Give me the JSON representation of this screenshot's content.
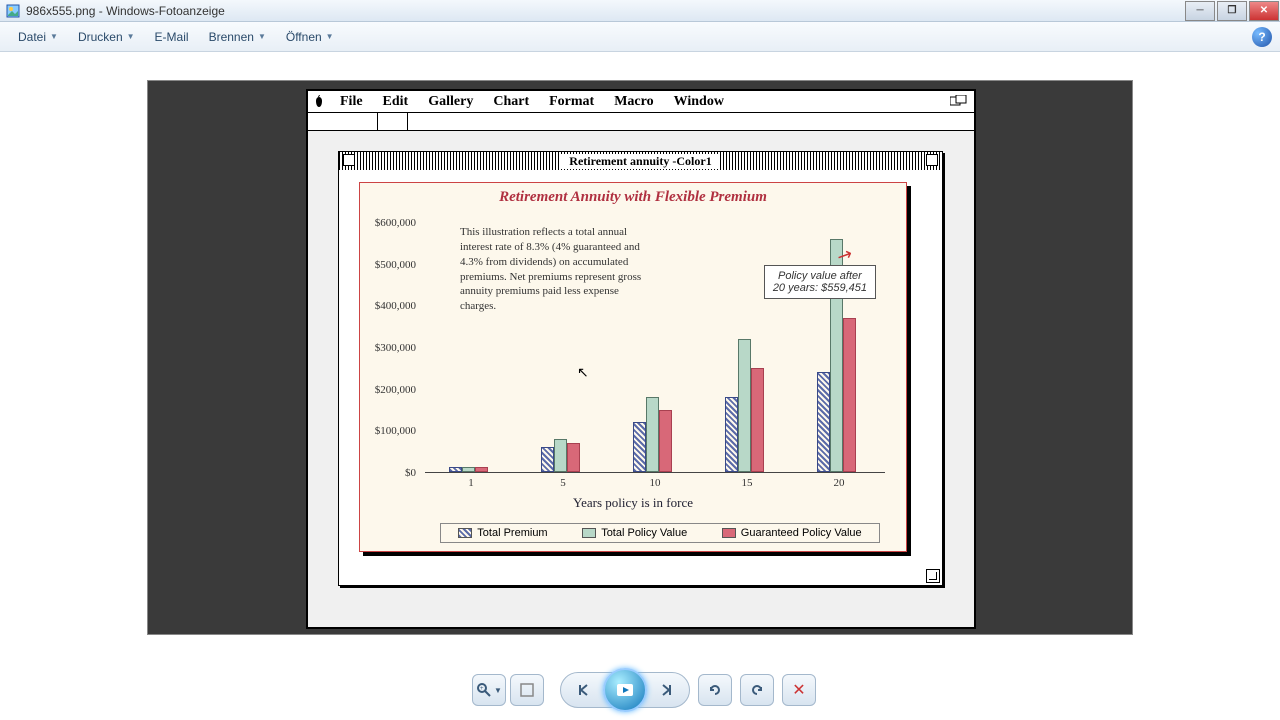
{
  "window": {
    "title": "986x555.png - Windows-Fotoanzeige"
  },
  "menubar": {
    "datei": "Datei",
    "drucken": "Drucken",
    "email": "E-Mail",
    "brennen": "Brennen",
    "oeffnen": "Öffnen"
  },
  "mac_menubar": {
    "file": "File",
    "edit": "Edit",
    "gallery": "Gallery",
    "chart": "Chart",
    "format": "Format",
    "macro": "Macro",
    "window": "Window"
  },
  "mac_doc": {
    "title": "Retirement annuity -Color1"
  },
  "chart": {
    "title": "Retirement Annuity with Flexible Premium",
    "note": "This illustration reflects a total annual interest rate of 8.3% (4% guaranteed and 4.3% from dividends) on accumulated premiums. Net premiums represent gross annuity premiums paid less expense charges.",
    "callout_line1": "Policy value after",
    "callout_line2": "20 years:  $559,451",
    "xlabel": "Years policy is in force",
    "yticks": [
      "$0",
      "$100,000",
      "$200,000",
      "$300,000",
      "$400,000",
      "$500,000",
      "$600,000"
    ],
    "xticks": [
      "1",
      "5",
      "10",
      "15",
      "20"
    ],
    "legend": {
      "premium": "Total Premium",
      "total": "Total Policy Value",
      "guaranteed": "Guaranteed Policy Value"
    }
  },
  "chart_data": {
    "type": "bar",
    "title": "Retirement Annuity with Flexible Premium",
    "xlabel": "Years policy is in force",
    "ylabel": "",
    "ylim": [
      0,
      600000
    ],
    "categories": [
      1,
      5,
      10,
      15,
      20
    ],
    "series": [
      {
        "name": "Total Premium",
        "values": [
          12000,
          60000,
          120000,
          180000,
          240000
        ]
      },
      {
        "name": "Total Policy Value",
        "values": [
          13000,
          80000,
          180000,
          320000,
          559451
        ]
      },
      {
        "name": "Guaranteed Policy Value",
        "values": [
          12500,
          70000,
          150000,
          250000,
          370000
        ]
      }
    ],
    "annotations": [
      {
        "text": "Policy value after 20 years: $559,451",
        "x": 20,
        "y": 559451
      }
    ]
  }
}
